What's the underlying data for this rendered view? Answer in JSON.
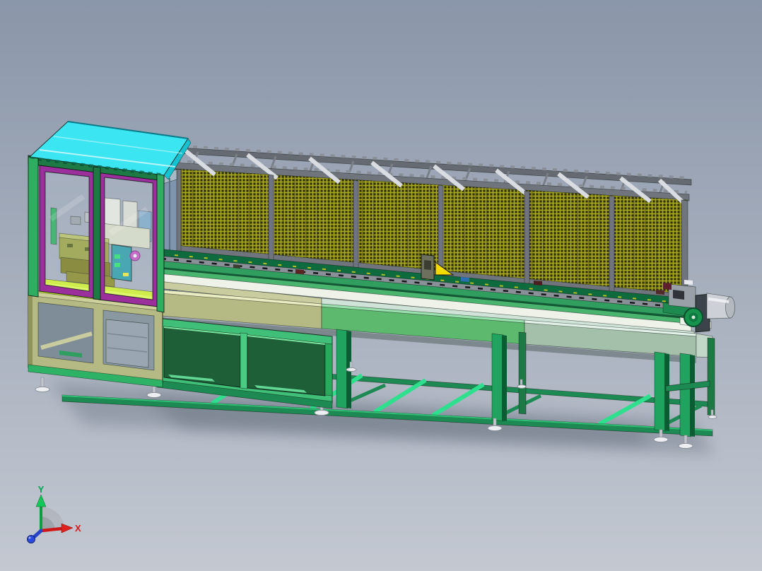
{
  "triad": {
    "x_label": "X",
    "y_label": "Y"
  },
  "colors": {
    "bg_top": "#8a96a9",
    "bg_bottom": "#c3c8d1",
    "roof_cyan": "#3be6f2",
    "door_purple": "#9b2f9b",
    "frame_green": "#2fae62",
    "frame_green_dark": "#1e7a45",
    "leg_green": "#1fa35f",
    "rail_green": "#1c8a52",
    "brace_teal": "#2ee08e",
    "cabinet_green": "#3fbf77",
    "cabinet_glass": "#1e5f38",
    "mesh_olive": "#a8a81e",
    "mesh_dark": "#2e2f0a",
    "bed_khaki": "#b5b983",
    "bed_green": "#5cb96d",
    "bed_sage": "#a4bfaa",
    "bed_white": "#eef2e8",
    "steel_gray": "#70757d",
    "steel_light": "#d9dce0",
    "panel_blue": "#7e95ad",
    "floor_lime": "#cdf02e",
    "motor_gray": "#cdd1d7",
    "pulley_green": "#17934e",
    "axis_x_red": "#e01414",
    "axis_y_green": "#00a550",
    "axis_z_blue": "#2d4ae0"
  }
}
